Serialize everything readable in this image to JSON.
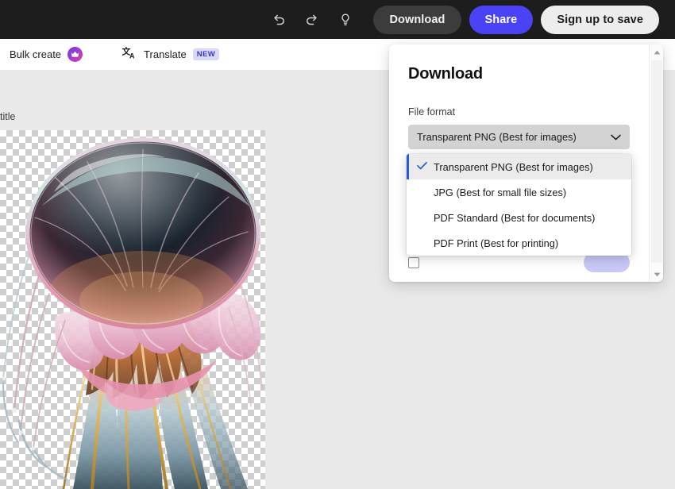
{
  "topbar": {
    "undo_icon": "undo-icon",
    "redo_icon": "redo-icon",
    "idea_icon": "lightbulb-icon",
    "download_label": "Download",
    "share_label": "Share",
    "signup_label": "Sign up to save",
    "background_color": "#1d1d1d",
    "share_color": "#4a42f5"
  },
  "subbar": {
    "bulk_create_label": "Bulk create",
    "crown_icon": "crown-icon",
    "translate_icon": "translate-icon",
    "translate_label": "Translate",
    "translate_badge": "NEW"
  },
  "editor": {
    "canvas_title": "title",
    "canvas_icon": "jellyfish-image"
  },
  "panel": {
    "title": "Download",
    "file_format_label": "File format",
    "selected_format": "Transparent PNG (Best for images)",
    "chevron_icon": "chevron-down-icon",
    "options": [
      {
        "label": "Transparent PNG (Best for images)",
        "selected": true
      },
      {
        "label": "JPG (Best for small file sizes)",
        "selected": false
      },
      {
        "label": "PDF Standard (Best for documents)",
        "selected": false
      },
      {
        "label": "PDF Print (Best for printing)",
        "selected": false
      }
    ],
    "check_icon": "check-icon",
    "accent_color": "#2b5ad6",
    "scroll_up_icon": "scroll-up-arrow-icon",
    "scroll_down_icon": "scroll-down-arrow-icon"
  }
}
